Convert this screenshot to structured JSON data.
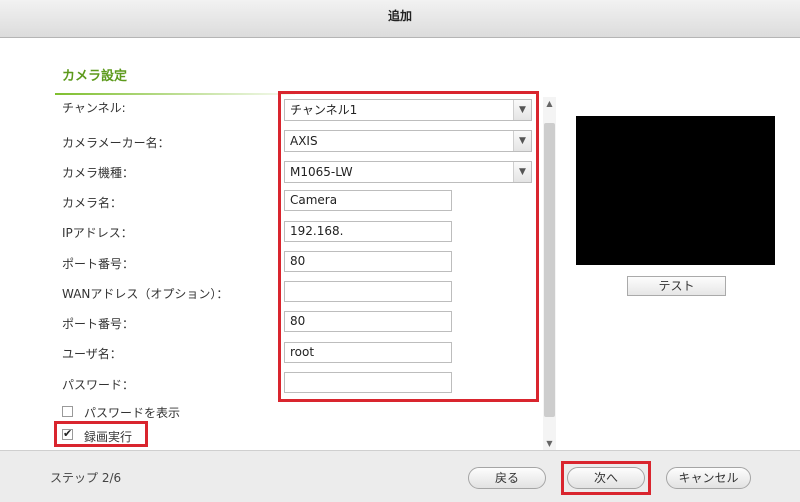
{
  "window": {
    "title": "追加"
  },
  "section": {
    "title": "カメラ設定"
  },
  "form": {
    "channel": {
      "label": "チャンネル:",
      "value": "チャンネル1"
    },
    "maker": {
      "label": "カメラメーカー名：",
      "value": "AXIS"
    },
    "model": {
      "label": "カメラ機種：",
      "value": "M1065-LW"
    },
    "camera_name": {
      "label": "カメラ名：",
      "value": "Camera"
    },
    "ip_address": {
      "label": "IPアドレス：",
      "value": "192.168."
    },
    "port": {
      "label": "ポート番号：",
      "value": "80"
    },
    "wan_address": {
      "label": "WANアドレス（オプション）：",
      "value": ""
    },
    "wan_port": {
      "label": "ポート番号：",
      "value": "80"
    },
    "username": {
      "label": "ユーザ名：",
      "value": "root"
    },
    "password": {
      "label": "パスワード：",
      "value": ""
    },
    "show_password": {
      "label": "パスワードを表示",
      "checked": false
    },
    "record": {
      "label": "録画実行",
      "checked": true
    }
  },
  "preview": {
    "test_label": "テスト"
  },
  "footer": {
    "step": "ステップ 2/6",
    "back_label": "戻る",
    "next_label": "次へ",
    "cancel_label": "キャンセル"
  },
  "colors": {
    "section_title": "#5d9a1c",
    "highlight": "#d9252e",
    "preview_bg": "#000000"
  },
  "icons": {
    "dropdown": "chevron-down-icon",
    "checkbox_checked": "check-icon"
  }
}
